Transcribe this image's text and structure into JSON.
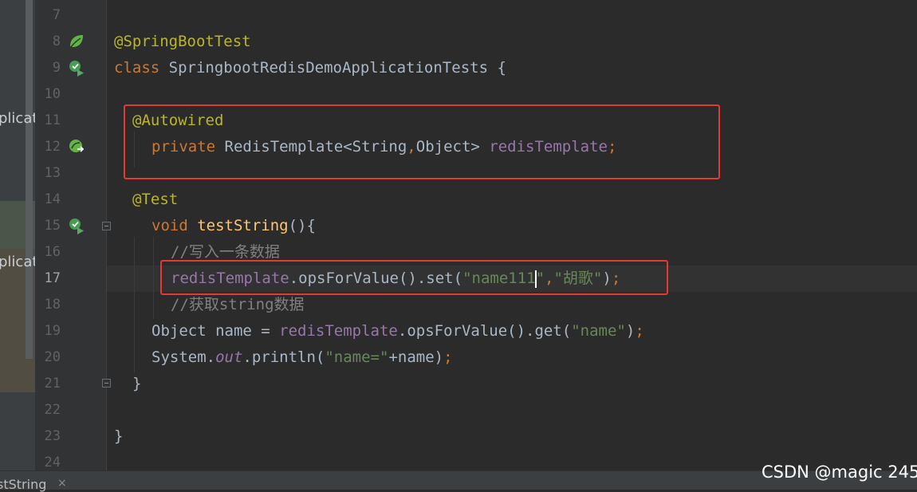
{
  "left_panel": {
    "items": [
      "plicat",
      "plicat"
    ]
  },
  "editor": {
    "current_line": "17",
    "line_numbers": [
      "7",
      "8",
      "9",
      "10",
      "11",
      "12",
      "13",
      "14",
      "15",
      "16",
      "17",
      "18",
      "19",
      "20",
      "21",
      "22",
      "23",
      "24"
    ],
    "tokens": {
      "springboottest": "@SpringBootTest",
      "class_kw": "class",
      "class_name": " SpringbootRedisDemoApplicationTests {",
      "autowired": "@Autowired",
      "private_kw": "private",
      "redis_type": " RedisTemplate<String",
      "comma1": ",",
      "object_gt": "Object> ",
      "redis_field": "redisTemplate",
      "semi": ";",
      "test_ann": "@Test",
      "void_kw": "void",
      "space": " ",
      "test_method": "testString",
      "parens_brace": "(){",
      "comment_write": "//写入一条数据",
      "redis_field2": "redisTemplate",
      "ops_set": ".opsForValue().set(",
      "str_name111_a": "\"name111",
      "str_name111_b": "\"",
      "comma2": ",",
      "str_huge": "\"胡歌\"",
      "close_paren": ")",
      "semi2": ";",
      "comment_get": "//获取string数据",
      "object_name": "Object name = ",
      "redis_field3": "redisTemplate",
      "ops_get": ".opsForValue().get(",
      "str_name": "\"name\"",
      "close_paren2": ")",
      "semi3": ";",
      "system": "System.",
      "out": "out",
      "println": ".println(",
      "str_name_eq": "\"name=\"",
      "plus_name": "+name)",
      "semi4": ";",
      "close_method": "}",
      "close_class": "}"
    }
  },
  "bottom_tab": {
    "label": "stString",
    "close": "×"
  },
  "watermark": "CSDN @magic 245",
  "colors": {
    "highlight_box": "#e53935",
    "spring_icon": "#62b543"
  }
}
